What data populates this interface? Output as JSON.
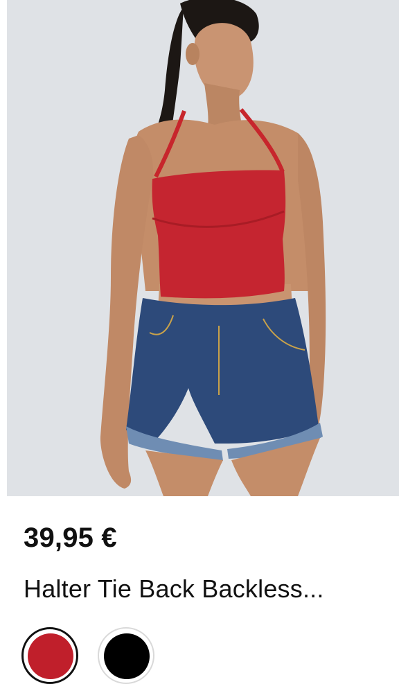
{
  "product": {
    "price": "39,95 €",
    "title": "Halter Tie Back Backless...",
    "image_description_icon": "product-photo",
    "colors": [
      {
        "name": "red",
        "hex": "#c01f2b",
        "selected": true
      },
      {
        "name": "black",
        "hex": "#000000",
        "selected": false
      }
    ],
    "image_background": "#dfe2e6"
  }
}
